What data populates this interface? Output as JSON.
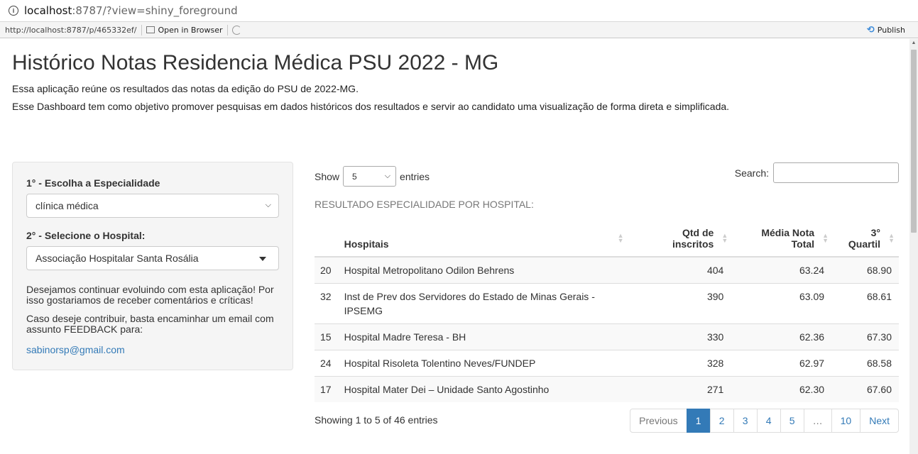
{
  "browser": {
    "url_host": "localhost",
    "url_rest": ":8787/?view=shiny_foreground",
    "toolbar_url": "http://localhost:8787/p/465332ef/",
    "open_in_browser": "Open in Browser",
    "publish": "Publish"
  },
  "page": {
    "title": "Histórico Notas Residencia Médica PSU 2022 - MG",
    "intro1": "Essa aplicação reúne os resultados das notas da edição do PSU de 2022-MG.",
    "intro2": "Esse Dashboard tem como objetivo promover pesquisas em dados históricos dos resultados e servir ao candidato uma visualização de forma direta e simplificada."
  },
  "sidebar": {
    "label_especialidade": "1° - Escolha a Especialidade",
    "especialidade_value": "clínica médica",
    "label_hospital": "2° - Selecione o Hospital:",
    "hospital_value": "Associação Hospitalar Santa Rosália",
    "text1": "Desejamos continuar evoluindo com esta aplicação! Por isso gostariamos de receber comentários e críticas!",
    "text2": "Caso deseje contribuir, basta encaminhar um email com assunto FEEDBACK para:",
    "email": "sabinorsp@gmail.com"
  },
  "table": {
    "show_label": "Show",
    "entries_value": "5",
    "entries_label": "entries",
    "search_label": "Search:",
    "caption": "RESULTADO ESPECIALIDADE POR HOSPITAL:",
    "headers": {
      "hospitais": "Hospitais",
      "qtd_line1": "Qtd de",
      "qtd_line2": "inscritos",
      "media_line1": "Média Nota",
      "media_line2": "Total",
      "q3_line1": "3°",
      "q3_line2": "Quartil"
    },
    "rows": [
      {
        "idx": "20",
        "hospital": "Hospital Metropolitano Odilon Behrens",
        "qtd": "404",
        "media": "63.24",
        "q3": "68.90"
      },
      {
        "idx": "32",
        "hospital": "Inst de Prev dos Servidores do Estado de Minas Gerais - IPSEMG",
        "qtd": "390",
        "media": "63.09",
        "q3": "68.61"
      },
      {
        "idx": "15",
        "hospital": "Hospital Madre Teresa - BH",
        "qtd": "330",
        "media": "62.36",
        "q3": "67.30"
      },
      {
        "idx": "24",
        "hospital": "Hospital Risoleta Tolentino Neves/FUNDEP",
        "qtd": "328",
        "media": "62.97",
        "q3": "68.58"
      },
      {
        "idx": "17",
        "hospital": "Hospital Mater Dei – Unidade Santo Agostinho",
        "qtd": "271",
        "media": "62.30",
        "q3": "67.60"
      }
    ],
    "info": "Showing 1 to 5 of 46 entries",
    "pagination": {
      "previous": "Previous",
      "pages": [
        "1",
        "2",
        "3",
        "4",
        "5",
        "…",
        "10"
      ],
      "next": "Next",
      "active_page": "1"
    }
  }
}
